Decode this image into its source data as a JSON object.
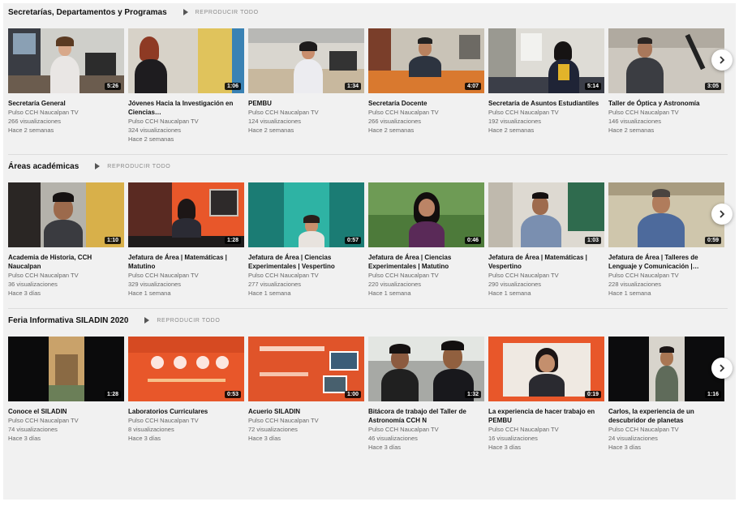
{
  "shelves": [
    {
      "title": "Secretarías, Departamentos y Programas",
      "play_all": "REPRODUCIR TODO",
      "videos": [
        {
          "title": "Secretaría General",
          "channel": "Pulso CCH Naucalpan TV",
          "views": "266 visualizaciones",
          "age": "Hace 2 semanas",
          "duration": "5:26"
        },
        {
          "title": "Jóvenes Hacia la Investigación en Ciencias…",
          "channel": "Pulso CCH Naucalpan TV",
          "views": "324 visualizaciones",
          "age": "Hace 2 semanas",
          "duration": "1:06"
        },
        {
          "title": "PEMBU",
          "channel": "Pulso CCH Naucalpan TV",
          "views": "124 visualizaciones",
          "age": "Hace 2 semanas",
          "duration": "1:34"
        },
        {
          "title": "Secretaría Docente",
          "channel": "Pulso CCH Naucalpan TV",
          "views": "266 visualizaciones",
          "age": "Hace 2 semanas",
          "duration": "4:07"
        },
        {
          "title": "Secretaría de Asuntos Estudiantiles",
          "channel": "Pulso CCH Naucalpan TV",
          "views": "192 visualizaciones",
          "age": "Hace 2 semanas",
          "duration": "5:14"
        },
        {
          "title": "Taller de Óptica y Astronomía",
          "channel": "Pulso CCH Naucalpan TV",
          "views": "146 visualizaciones",
          "age": "Hace 2 semanas",
          "duration": "3:05"
        }
      ]
    },
    {
      "title": "Áreas académicas",
      "play_all": "REPRODUCIR TODO",
      "videos": [
        {
          "title": "Academia de Historia, CCH Naucalpan",
          "channel": "Pulso CCH Naucalpan TV",
          "views": "36 visualizaciones",
          "age": "Hace 3 días",
          "duration": "1:10"
        },
        {
          "title": "Jefatura de Área | Matemáticas | Matutino",
          "channel": "Pulso CCH Naucalpan TV",
          "views": "329 visualizaciones",
          "age": "Hace 1 semana",
          "duration": "1:28"
        },
        {
          "title": "Jefatura de Área | Ciencias Experimentales | Vespertino",
          "channel": "Pulso CCH Naucalpan TV",
          "views": "277 visualizaciones",
          "age": "Hace 1 semana",
          "duration": "0:57"
        },
        {
          "title": "Jefatura de Área | Ciencias Experimentales | Matutino",
          "channel": "Pulso CCH Naucalpan TV",
          "views": "220 visualizaciones",
          "age": "Hace 1 semana",
          "duration": "0:46"
        },
        {
          "title": "Jefatura de Área | Matemáticas | Vespertino",
          "channel": "Pulso CCH Naucalpan TV",
          "views": "290 visualizaciones",
          "age": "Hace 1 semana",
          "duration": "1:03"
        },
        {
          "title": "Jefatura de Área | Talleres de Lenguaje y Comunicación |…",
          "channel": "Pulso CCH Naucalpan TV",
          "views": "228 visualizaciones",
          "age": "Hace 1 semana",
          "duration": "0:59"
        }
      ]
    },
    {
      "title": "Feria Informativa SILADIN 2020",
      "play_all": "REPRODUCIR TODO",
      "videos": [
        {
          "title": "Conoce el SILADIN",
          "channel": "Pulso CCH Naucalpan TV",
          "views": "74 visualizaciones",
          "age": "Hace 3 días",
          "duration": "1:28"
        },
        {
          "title": "Laboratorios Curriculares",
          "channel": "Pulso CCH Naucalpan TV",
          "views": "8 visualizaciones",
          "age": "Hace 3 días",
          "duration": "0:53"
        },
        {
          "title": "Acuerio SILADIN",
          "channel": "Pulso CCH Naucalpan TV",
          "views": "72 visualizaciones",
          "age": "Hace 3 días",
          "duration": "1:00"
        },
        {
          "title": "Bitácora de trabajo del Taller de Astronomía CCH N",
          "channel": "Pulso CCH Naucalpan TV",
          "views": "46 visualizaciones",
          "age": "Hace 3 días",
          "duration": "1:32"
        },
        {
          "title": "La experiencia de hacer trabajo en PEMBU",
          "channel": "Pulso CCH Naucalpan TV",
          "views": "16 visualizaciones",
          "age": "Hace 3 días",
          "duration": "0:19"
        },
        {
          "title": "Carlos, la experiencia de un descubridor de planetas",
          "channel": "Pulso CCH Naucalpan TV",
          "views": "24 visualizaciones",
          "age": "Hace 3 días",
          "duration": "1:16"
        }
      ]
    }
  ],
  "icons": {
    "next": "chevron-right-icon",
    "play_all": "play-triangle-icon"
  },
  "colors": {
    "thumb_orange": "#e8572a",
    "bg": "#f1f1f1",
    "meta": "#666666"
  }
}
